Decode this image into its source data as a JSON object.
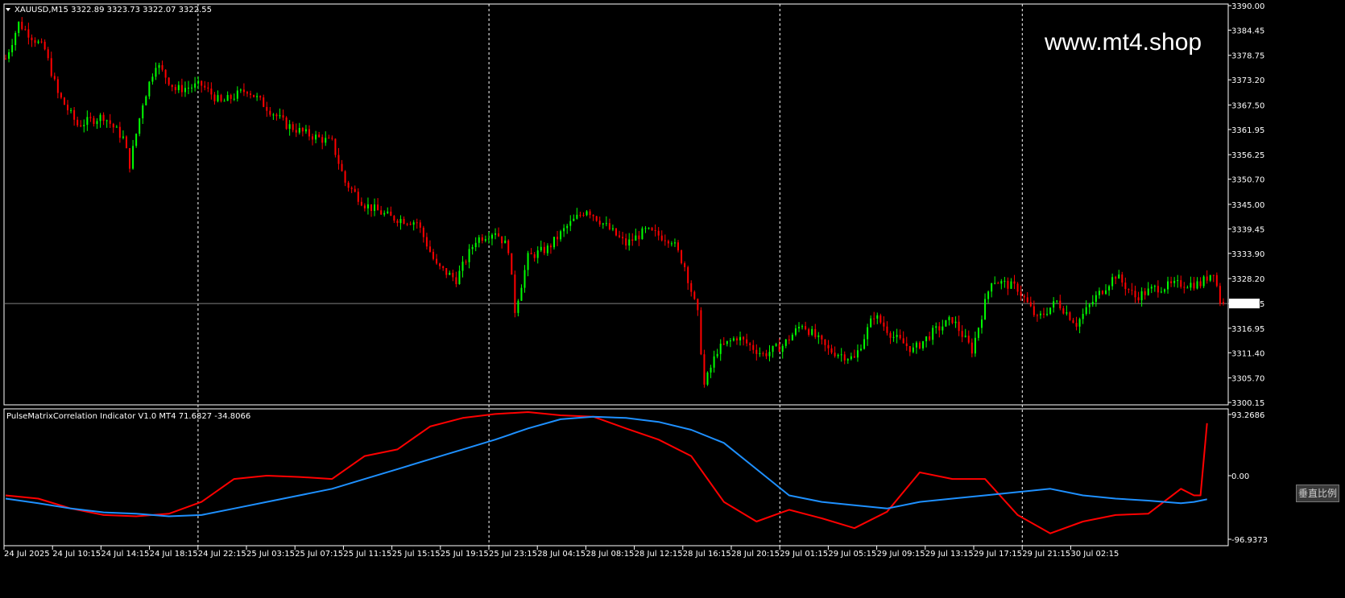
{
  "watermark": "www.mt4.shop",
  "main_header": "XAUUSD,M15  3322.89 3323.73 3322.07 3322.55",
  "indicator_header": "PulseMatrixCorrelation Indicator V1.0 MT4 71.6827 -34.8066",
  "scale_button_label": "垂直比例",
  "colors": {
    "background": "#000000",
    "bull_candle": "#00ff00",
    "bear_candle": "#ff0000",
    "fast_line": "#ff0000",
    "slow_line": "#1e90ff",
    "grid": "#ffffff",
    "price_line": "#808080"
  },
  "chart_data": [
    {
      "type": "candlestick",
      "symbol": "XAUUSD",
      "timeframe": "M15",
      "last": {
        "open": 3322.89,
        "high": 3323.73,
        "low": 3322.07,
        "close": 3322.55
      },
      "y_ticks": [
        "3390.00",
        "3384.45",
        "3378.75",
        "3373.20",
        "3367.50",
        "3361.95",
        "3356.25",
        "3350.70",
        "3345.00",
        "3339.45",
        "3333.90",
        "3328.20",
        "3322.55",
        "3316.95",
        "3311.40",
        "3305.70",
        "3300.15"
      ],
      "ylim": [
        3300.15,
        3390.0
      ],
      "current_price_label": "3322.55",
      "x_ticks": [
        "24 Jul 2025",
        "24 Jul 10:15",
        "24 Jul 14:15",
        "24 Jul 18:15",
        "24 Jul 22:15",
        "25 Jul 03:15",
        "25 Jul 07:15",
        "25 Jul 11:15",
        "25 Jul 15:15",
        "25 Jul 19:15",
        "25 Jul 23:15",
        "28 Jul 04:15",
        "28 Jul 08:15",
        "28 Jul 12:15",
        "28 Jul 16:15",
        "28 Jul 20:15",
        "29 Jul 01:15",
        "29 Jul 05:15",
        "29 Jul 09:15",
        "29 Jul 13:15",
        "29 Jul 17:15",
        "29 Jul 21:15",
        "30 Jul 02:15"
      ],
      "price_path": [
        [
          0,
          3378
        ],
        [
          4,
          3386
        ],
        [
          12,
          3380
        ],
        [
          16,
          3370
        ],
        [
          22,
          3363
        ],
        [
          30,
          3365
        ],
        [
          36,
          3360
        ],
        [
          38,
          3354
        ],
        [
          42,
          3368
        ],
        [
          46,
          3377
        ],
        [
          52,
          3371
        ],
        [
          60,
          3372
        ],
        [
          66,
          3368
        ],
        [
          74,
          3371
        ],
        [
          80,
          3367
        ],
        [
          86,
          3363
        ],
        [
          92,
          3361
        ],
        [
          100,
          3359
        ],
        [
          104,
          3350
        ],
        [
          110,
          3345
        ],
        [
          118,
          3342
        ],
        [
          126,
          3341
        ],
        [
          132,
          3331
        ],
        [
          138,
          3328
        ],
        [
          144,
          3337
        ],
        [
          150,
          3339
        ],
        [
          154,
          3335
        ],
        [
          156,
          3321
        ],
        [
          160,
          3333
        ],
        [
          166,
          3335
        ],
        [
          172,
          3340
        ],
        [
          178,
          3344
        ],
        [
          184,
          3340
        ],
        [
          190,
          3336
        ],
        [
          196,
          3339
        ],
        [
          204,
          3337
        ],
        [
          208,
          3331
        ],
        [
          212,
          3320
        ],
        [
          214,
          3304
        ],
        [
          218,
          3312
        ],
        [
          224,
          3315
        ],
        [
          232,
          3311
        ],
        [
          238,
          3313
        ],
        [
          244,
          3318
        ],
        [
          252,
          3312
        ],
        [
          260,
          3310
        ],
        [
          266,
          3320
        ],
        [
          272,
          3315
        ],
        [
          278,
          3312
        ],
        [
          284,
          3316
        ],
        [
          290,
          3319
        ],
        [
          296,
          3312
        ],
        [
          302,
          3328
        ],
        [
          310,
          3326
        ],
        [
          316,
          3319
        ],
        [
          322,
          3323
        ],
        [
          328,
          3318
        ],
        [
          334,
          3324
        ],
        [
          340,
          3329
        ],
        [
          346,
          3324
        ],
        [
          352,
          3326
        ],
        [
          360,
          3327
        ],
        [
          366,
          3327
        ],
        [
          370,
          3330
        ],
        [
          372,
          3323
        ]
      ],
      "vertical_separators": [
        "24 Jul 22:15",
        "25 Jul 23:15",
        "29 Jul 01:15",
        "29 Jul 21:15"
      ]
    },
    {
      "type": "line",
      "title": "PulseMatrixCorrelation Indicator V1.0 MT4",
      "values_shown": [
        71.6827,
        -34.8066
      ],
      "y_ticks": [
        "93.2686",
        "0.00",
        "-96.9373"
      ],
      "ylim": [
        -96.9373,
        93.2686
      ],
      "x": [
        0,
        10,
        20,
        30,
        40,
        50,
        60,
        70,
        80,
        90,
        100,
        110,
        120,
        130,
        140,
        150,
        160,
        170,
        180,
        190,
        200,
        210,
        220,
        230,
        240,
        250,
        260,
        270,
        280,
        290,
        300,
        310,
        320,
        330,
        340,
        350,
        360,
        364,
        366,
        368
      ],
      "series": [
        {
          "values": [
            -30,
            -35,
            -50,
            -60,
            -62,
            -58,
            -40,
            -5,
            0,
            -2,
            -5,
            30,
            40,
            75,
            88,
            94,
            97,
            92,
            90,
            72,
            55,
            30,
            -40,
            -70,
            -52,
            -65,
            -80,
            -55,
            5,
            -5,
            -5,
            -60,
            -88,
            -70,
            -60,
            -58,
            -20,
            -30,
            -30,
            80
          ]
        },
        {
          "values": [
            -35,
            -42,
            -50,
            -56,
            -58,
            -62,
            -60,
            -50,
            -40,
            -30,
            -20,
            -5,
            10,
            25,
            40,
            55,
            72,
            86,
            90,
            88,
            82,
            70,
            50,
            10,
            -30,
            -40,
            -45,
            -50,
            -40,
            -35,
            -30,
            -25,
            -20,
            -30,
            -35,
            -38,
            -42,
            -40,
            -38,
            -36
          ]
        }
      ]
    }
  ]
}
